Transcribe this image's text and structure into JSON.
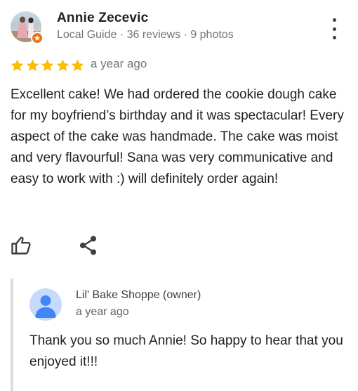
{
  "reviewer": {
    "name": "Annie Zecevic",
    "meta": "Local Guide · 36 reviews · 9 photos",
    "avatar_icon": "profile-photo",
    "badge_icon": "local-guide-star-icon",
    "badge_color": "#e8711a"
  },
  "rating": {
    "stars": 5,
    "max_stars": 5,
    "star_color": "#fbbc04",
    "date": "a year ago"
  },
  "review": {
    "text": "Excellent cake! We had ordered the cookie dough cake for my boyfriend’s birthday and it was spectacular! Every aspect of the cake was handmade. The cake was moist and very flavourful! Sana was very communicative and easy to work with :) will definitely order again!"
  },
  "actions": {
    "like_icon": "thumbs-up-icon",
    "share_icon": "share-icon",
    "more_icon": "more-vert-icon"
  },
  "owner_reply": {
    "name": "Lil' Bake Shoppe (owner)",
    "date": "a year ago",
    "text": "Thank you so much Annie! So happy to hear that you enjoyed it!!!",
    "avatar_icon": "default-person-icon",
    "avatar_color": "#c6dafc",
    "avatar_figure_color": "#4285f4"
  }
}
